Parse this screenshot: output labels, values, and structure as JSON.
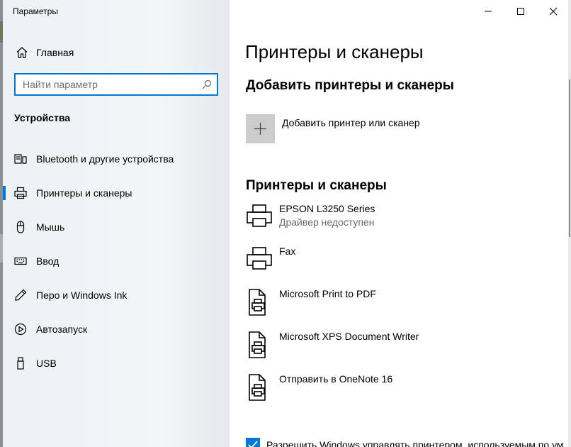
{
  "window": {
    "title": "Параметры"
  },
  "sidebar": {
    "home_label": "Главная",
    "search_placeholder": "Найти параметр",
    "section": "Устройства",
    "items": [
      {
        "label": "Bluetooth и другие устройства",
        "icon": "bluetooth-devices-icon"
      },
      {
        "label": "Принтеры и сканеры",
        "icon": "printer-icon",
        "active": true
      },
      {
        "label": "Мышь",
        "icon": "mouse-icon"
      },
      {
        "label": "Ввод",
        "icon": "keyboard-icon"
      },
      {
        "label": "Перо и Windows Ink",
        "icon": "pen-icon"
      },
      {
        "label": "Автозапуск",
        "icon": "autoplay-icon"
      },
      {
        "label": "USB",
        "icon": "usb-icon"
      }
    ]
  },
  "main": {
    "title": "Принтеры и сканеры",
    "add_section_title": "Добавить принтеры и сканеры",
    "add_button_label": "Добавить принтер или сканер",
    "list_title": "Принтеры и сканеры",
    "printers": [
      {
        "name": "EPSON L3250 Series",
        "status": "Драйвер недоступен",
        "icon": "printer-icon"
      },
      {
        "name": "Fax",
        "status": "",
        "icon": "printer-icon"
      },
      {
        "name": "Microsoft Print to PDF",
        "status": "",
        "icon": "document-printer-icon"
      },
      {
        "name": "Microsoft XPS Document Writer",
        "status": "",
        "icon": "document-printer-icon"
      },
      {
        "name": "Отправить в OneNote 16",
        "status": "",
        "icon": "document-printer-icon"
      }
    ],
    "checkbox_label": "Разрешить Windows управлять принтером, используемым по умолчанию",
    "checkbox_checked": true
  },
  "colors": {
    "accent": "#0078d7",
    "add_tile": "#cccccc",
    "status_text": "#6b6b6b"
  }
}
